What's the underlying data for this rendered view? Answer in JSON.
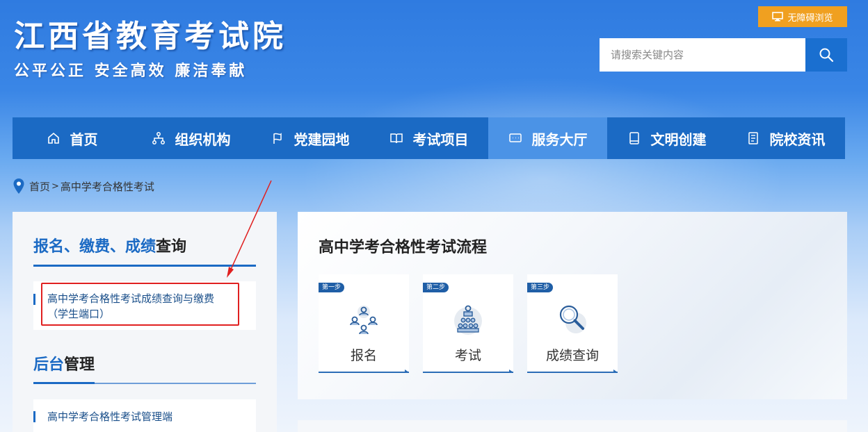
{
  "header": {
    "site_title": "江西省教育考试院",
    "site_motto": "公平公正  安全高效  廉洁奉献",
    "accessibility_label": "无障碍浏览",
    "search_placeholder": "请搜索关键内容"
  },
  "nav": {
    "items": [
      {
        "label": "首页",
        "icon": "home-icon"
      },
      {
        "label": "组织机构",
        "icon": "org-icon"
      },
      {
        "label": "党建园地",
        "icon": "party-icon"
      },
      {
        "label": "考试项目",
        "icon": "book-icon"
      },
      {
        "label": "服务大厅",
        "icon": "service-icon",
        "active": true
      },
      {
        "label": "文明创建",
        "icon": "notebook-icon"
      },
      {
        "label": "院校资讯",
        "icon": "news-icon"
      }
    ]
  },
  "breadcrumb": {
    "home": "首页",
    "separator": ">",
    "current": "高中学考合格性考试"
  },
  "sidebar": {
    "section1": {
      "title_blue": "报名、缴费、成绩",
      "title_dark": "查询",
      "link_line1": "高中学考合格性考试成绩查询与缴费",
      "link_line2": "（学生端口）"
    },
    "section2": {
      "title_blue": "后台",
      "title_dark": "管理",
      "link": "高中学考合格性考试管理端"
    }
  },
  "panel": {
    "title": "高中学考合格性考试流程",
    "steps": [
      {
        "badge": "第一步",
        "label": "报名",
        "icon": "group-users-icon"
      },
      {
        "badge": "第二步",
        "label": "考试",
        "icon": "exam-hall-icon"
      },
      {
        "badge": "第三步",
        "label": "成绩查询",
        "icon": "magnifier-icon"
      }
    ]
  },
  "colors": {
    "nav_bg": "#1b6ac4",
    "nav_active": "#4b93e6",
    "accessibility_bg": "#f0a020",
    "annotation_red": "#e02020"
  }
}
